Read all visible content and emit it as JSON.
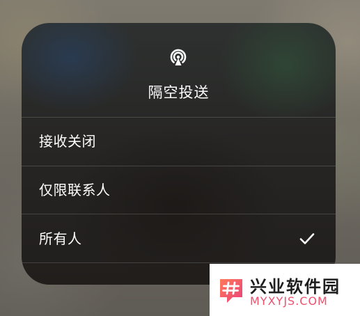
{
  "airdrop_menu": {
    "icon": "airdrop-icon",
    "title": "隔空投送",
    "options": [
      {
        "label": "接收关闭",
        "selected": false
      },
      {
        "label": "仅限联系人",
        "selected": false
      },
      {
        "label": "所有人",
        "selected": true
      }
    ],
    "check_icon": "checkmark-icon"
  },
  "watermark": {
    "name": "兴业软件园",
    "site": "MYXYJS.COM",
    "logo_icon": "hash-logo-icon",
    "accent_color": "#f0506e"
  }
}
